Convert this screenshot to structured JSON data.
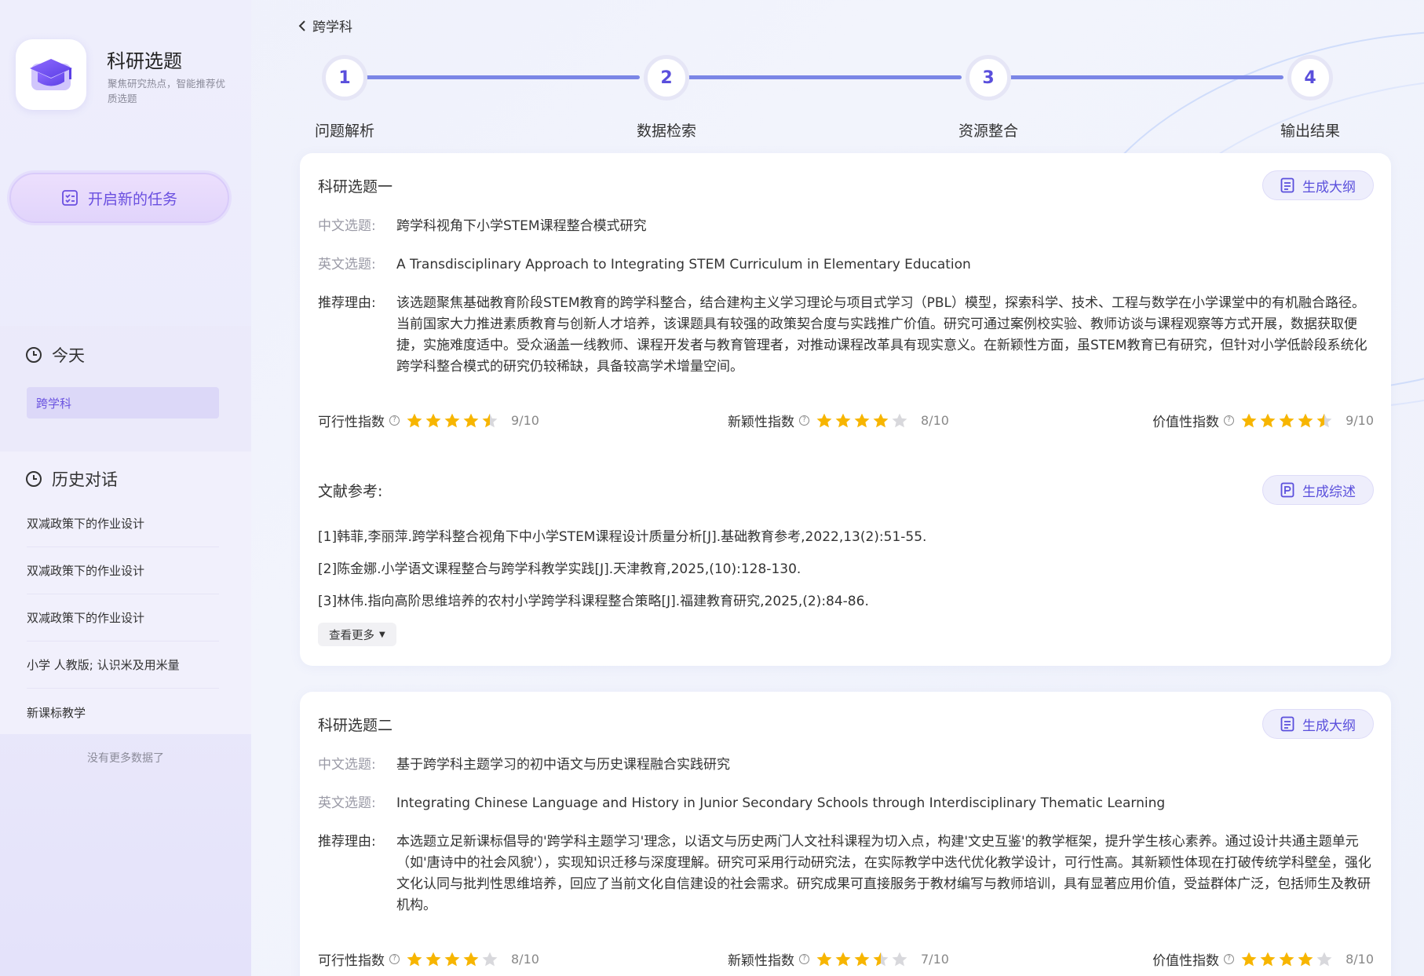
{
  "app": {
    "title": "科研选题",
    "subtitle": "聚焦研究热点，智能推荐优质选题"
  },
  "sidebar": {
    "new_task_label": "开启新的任务",
    "today_label": "今天",
    "today_items": [
      "跨学科"
    ],
    "history_label": "历史对话",
    "history_items": [
      "双减政策下的作业设计",
      "双减政策下的作业设计",
      "双减政策下的作业设计",
      "小学 人教版; 认识米及用米量",
      "新课标教学"
    ],
    "no_more": "没有更多数据了"
  },
  "header": {
    "back_label": "跨学科"
  },
  "steps": [
    {
      "num": "1",
      "label": "问题解析"
    },
    {
      "num": "2",
      "label": "数据检索"
    },
    {
      "num": "3",
      "label": "资源整合"
    },
    {
      "num": "4",
      "label": "输出结果"
    }
  ],
  "labels": {
    "cn": "中文选题:",
    "en": "英文选题:",
    "reason": "推荐理由:",
    "feasibility": "可行性指数",
    "novelty": "新颖性指数",
    "value": "价值性指数",
    "outline_btn": "生成大纲",
    "review_btn": "生成综述",
    "refs_title": "文献参考:",
    "see_more": "查看更多"
  },
  "topics": [
    {
      "title": "科研选题一",
      "cn": "跨学科视角下小学STEM课程整合模式研究",
      "en": "A Transdisciplinary Approach to Integrating STEM Curriculum in Elementary Education",
      "reason": "该选题聚焦基础教育阶段STEM教育的跨学科整合，结合建构主义学习理论与项目式学习（PBL）模型，探索科学、技术、工程与数学在小学课堂中的有机融合路径。当前国家大力推进素质教育与创新人才培养，该课题具有较强的政策契合度与实践推广价值。研究可通过案例校实验、教师访谈与课程观察等方式开展，数据获取便捷，实施难度适中。受众涵盖一线教师、课程开发者与教育管理者，对推动课程改革具有现实意义。在新颖性方面，虽STEM教育已有研究，但针对小学低龄段系统化跨学科整合模式的研究仍较稀缺，具备较高学术增量空间。",
      "feasibility": {
        "score": "9/10",
        "value": 9
      },
      "novelty": {
        "score": "8/10",
        "value": 8
      },
      "value": {
        "score": "9/10",
        "value": 9
      },
      "refs": [
        "[1]韩菲,李丽萍.跨学科整合视角下中小学STEM课程设计质量分析[J].基础教育参考,2022,13(2):51-55.",
        "[2]陈金娜.小学语文课程整合与跨学科教学实践[J].天津教育,2025,(10):128-130.",
        "[3]林伟.指向高阶思维培养的农村小学跨学科课程整合策略[J].福建教育研究,2025,(2):84-86."
      ]
    },
    {
      "title": "科研选题二",
      "cn": "基于跨学科主题学习的初中语文与历史课程融合实践研究",
      "en": "Integrating Chinese Language and History in Junior Secondary Schools through Interdisciplinary Thematic Learning",
      "reason": "本选题立足新课标倡导的'跨学科主题学习'理念，以语文与历史两门人文社科课程为切入点，构建'文史互鉴'的教学框架，提升学生核心素养。通过设计共通主题单元（如'唐诗中的社会风貌'），实现知识迁移与深度理解。研究可采用行动研究法，在实际教学中迭代优化教学设计，可行性高。其新颖性体现在打破传统学科壁垒，强化文化认同与批判性思维培养，回应了当前文化自信建设的社会需求。研究成果可直接服务于教材编写与教师培训，具有显著应用价值，受益群体广泛，包括师生及教研机构。",
      "feasibility": {
        "score": "8/10",
        "value": 8
      },
      "novelty": {
        "score": "7/10",
        "value": 7
      },
      "value": {
        "score": "8/10",
        "value": 8
      }
    }
  ],
  "colors": {
    "accent": "#5a4fdc",
    "star": "#f7b500",
    "star_empty": "#d8d8dc"
  }
}
